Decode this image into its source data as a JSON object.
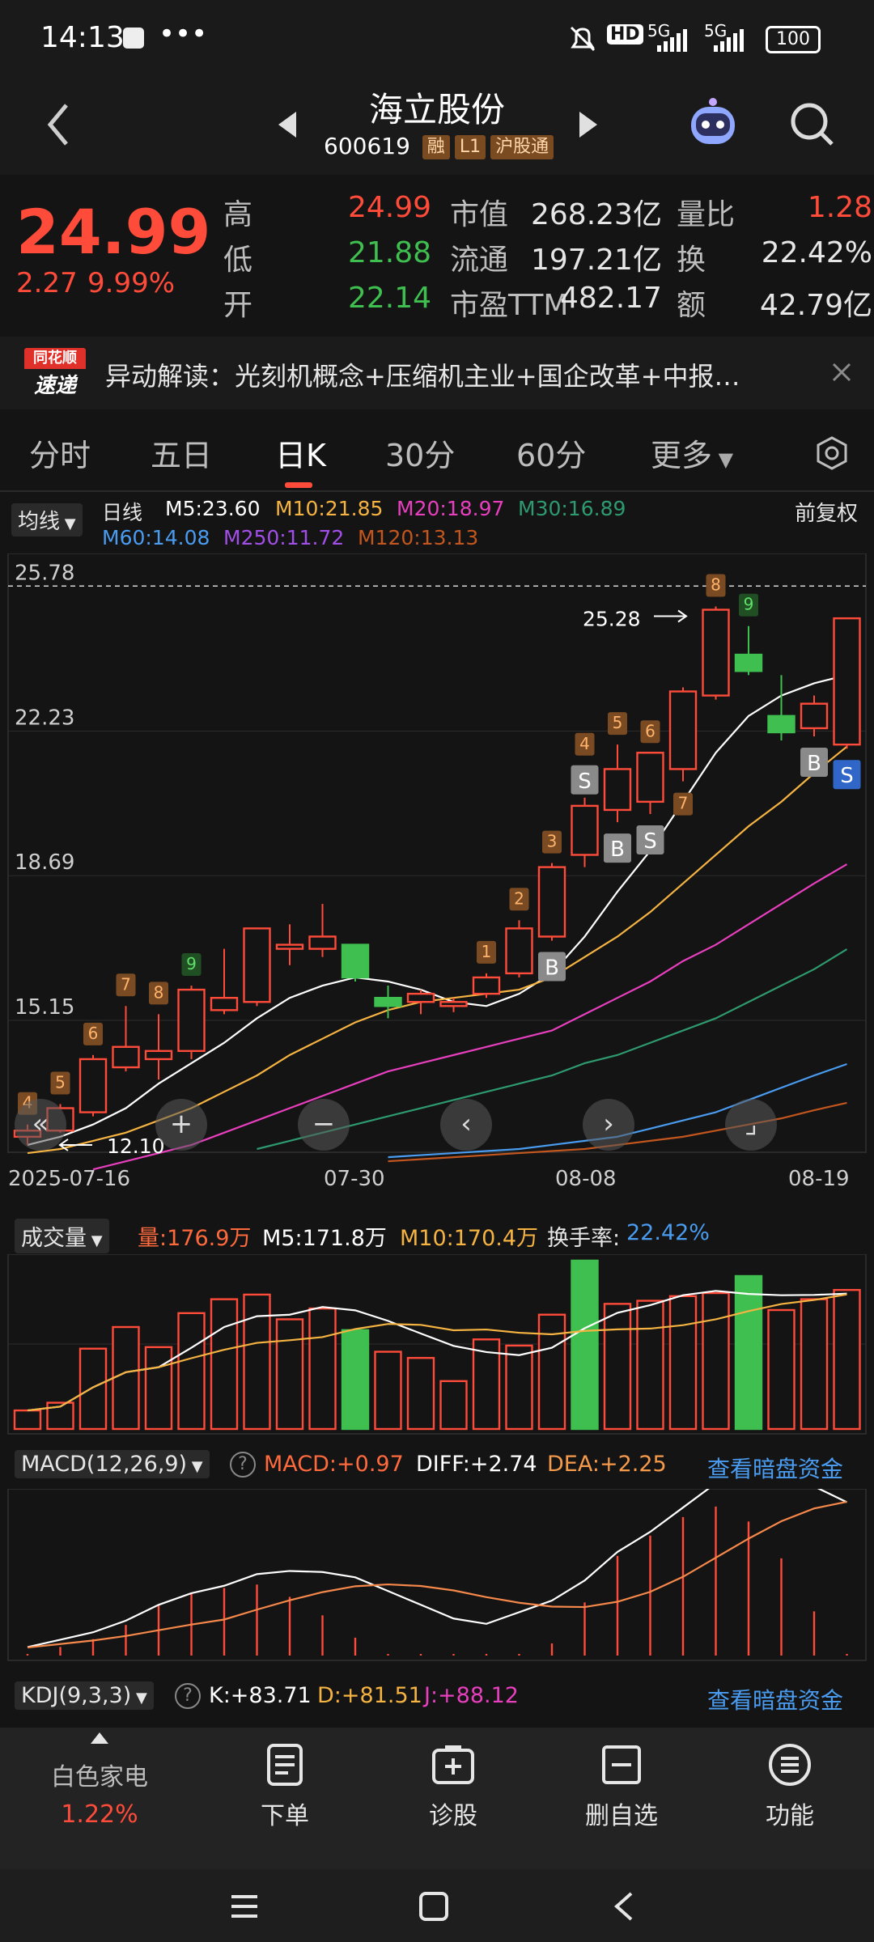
{
  "status": {
    "time": "14:13",
    "dots": "•••",
    "hd": "HD",
    "net1": "5G",
    "net2": "5G",
    "battery": "100"
  },
  "header": {
    "title": "海立股份",
    "code": "600619",
    "badges": [
      "融",
      "L1",
      "沪股通"
    ]
  },
  "quote": {
    "price": "24.99",
    "change": "2.27",
    "change_pct": "9.99%",
    "high_label": "高",
    "high": "24.99",
    "low_label": "低",
    "low": "21.88",
    "open_label": "开",
    "open": "22.14",
    "mcap_label": "市值",
    "mcap": "268.23亿",
    "float_label": "流通",
    "float": "197.21亿",
    "pe_label": "市盈TTM",
    "pe": "482.17",
    "volratio_label": "量比",
    "volratio": "1.28",
    "turnover_label": "换",
    "turnover": "22.42%",
    "amount_label": "额",
    "amount": "42.79亿"
  },
  "news": {
    "logo_top": "同花顺",
    "logo_bottom": "速递",
    "text": "异动解读：光刻机概念+压缩机主业+国企改革+中报…"
  },
  "tabs": [
    "分时",
    "五日",
    "日K",
    "30分",
    "60分",
    "更多"
  ],
  "ma_row": {
    "selector": "均线",
    "period": "日线",
    "m5": "M5:23.60",
    "m10": "M10:21.85",
    "m20": "M20:18.97",
    "m30": "M30:16.89",
    "m60": "M60:14.08",
    "m250": "M250:11.72",
    "m120": "M120:13.13",
    "adjust": "前复权",
    "colors": {
      "m5": "#ffffff",
      "m10": "#f5b342",
      "m20": "#e83fbf",
      "m30": "#2e9a6f",
      "m60": "#4a9cf0",
      "m250": "#a24ee8",
      "m120": "#c2561e"
    }
  },
  "chart_data": {
    "type": "candlestick",
    "y_ticks": [
      "25.78",
      "22.23",
      "18.69",
      "15.15"
    ],
    "x_ticks": [
      "2025-07-16",
      "07-30",
      "08-08",
      "08-19"
    ],
    "ylim": [
      12.0,
      26.3
    ],
    "high_annotation": "25.28",
    "low_annotation": "12.10",
    "candles": [
      {
        "o": 12.3,
        "h": 12.6,
        "l": 12.1,
        "c": 12.45
      },
      {
        "o": 12.45,
        "h": 13.1,
        "l": 12.4,
        "c": 13.0
      },
      {
        "o": 12.9,
        "h": 14.3,
        "l": 12.8,
        "c": 14.2
      },
      {
        "o": 14.0,
        "h": 15.5,
        "l": 13.9,
        "c": 14.5
      },
      {
        "o": 14.2,
        "h": 15.3,
        "l": 13.7,
        "c": 14.4
      },
      {
        "o": 14.4,
        "h": 16.0,
        "l": 14.2,
        "c": 15.9
      },
      {
        "o": 15.4,
        "h": 16.9,
        "l": 15.3,
        "c": 15.7
      },
      {
        "o": 15.6,
        "h": 17.3,
        "l": 15.5,
        "c": 17.4
      },
      {
        "o": 16.9,
        "h": 17.5,
        "l": 16.5,
        "c": 17.0
      },
      {
        "o": 16.9,
        "h": 18.0,
        "l": 16.7,
        "c": 17.2
      },
      {
        "o": 17.0,
        "h": 17.0,
        "l": 16.1,
        "c": 16.2
      },
      {
        "o": 15.7,
        "h": 16.0,
        "l": 15.2,
        "c": 15.5
      },
      {
        "o": 15.6,
        "h": 15.9,
        "l": 15.3,
        "c": 15.8
      },
      {
        "o": 15.5,
        "h": 15.7,
        "l": 15.35,
        "c": 15.6
      },
      {
        "o": 15.8,
        "h": 16.3,
        "l": 15.7,
        "c": 16.2
      },
      {
        "o": 16.3,
        "h": 17.6,
        "l": 16.2,
        "c": 17.4
      },
      {
        "o": 17.2,
        "h": 19.0,
        "l": 17.1,
        "c": 18.9
      },
      {
        "o": 19.2,
        "h": 20.6,
        "l": 18.9,
        "c": 20.4
      },
      {
        "o": 20.3,
        "h": 21.9,
        "l": 20.0,
        "c": 21.3
      },
      {
        "o": 20.5,
        "h": 21.7,
        "l": 20.2,
        "c": 21.7
      },
      {
        "o": 21.3,
        "h": 23.3,
        "l": 21.0,
        "c": 23.2
      },
      {
        "o": 23.1,
        "h": 25.28,
        "l": 23.0,
        "c": 25.2
      },
      {
        "o": 24.1,
        "h": 24.8,
        "l": 23.6,
        "c": 23.7
      },
      {
        "o": 22.6,
        "h": 23.6,
        "l": 22.0,
        "c": 22.2
      },
      {
        "o": 22.3,
        "h": 23.1,
        "l": 22.1,
        "c": 22.9
      },
      {
        "o": 21.9,
        "h": 25.0,
        "l": 21.8,
        "c": 24.99
      }
    ],
    "series": [
      {
        "name": "M5",
        "values": [
          12.1,
          12.3,
          12.6,
          13.0,
          13.6,
          14.1,
          14.6,
          15.2,
          15.7,
          16.0,
          16.2,
          16.1,
          15.9,
          15.6,
          15.5,
          15.8,
          16.3,
          17.2,
          18.3,
          19.3,
          20.5,
          21.7,
          22.6,
          23.1,
          23.4,
          23.6
        ]
      },
      {
        "name": "M10",
        "values": [
          11.9,
          12.0,
          12.2,
          12.4,
          12.7,
          13.0,
          13.4,
          13.8,
          14.3,
          14.7,
          15.1,
          15.4,
          15.6,
          15.7,
          15.8,
          15.9,
          16.2,
          16.7,
          17.2,
          17.8,
          18.5,
          19.2,
          19.9,
          20.5,
          21.2,
          21.85
        ]
      },
      {
        "name": "M20",
        "values": [
          null,
          null,
          11.5,
          11.7,
          11.9,
          12.1,
          12.4,
          12.7,
          13.0,
          13.3,
          13.6,
          13.9,
          14.1,
          14.3,
          14.5,
          14.7,
          14.9,
          15.3,
          15.7,
          16.1,
          16.6,
          17.0,
          17.5,
          18.0,
          18.5,
          18.97
        ]
      },
      {
        "name": "M30",
        "values": [
          null,
          null,
          null,
          null,
          null,
          null,
          null,
          12.0,
          12.2,
          12.4,
          12.6,
          12.8,
          13.0,
          13.2,
          13.4,
          13.6,
          13.8,
          14.1,
          14.3,
          14.6,
          14.9,
          15.2,
          15.6,
          16.0,
          16.4,
          16.89
        ]
      },
      {
        "name": "M60",
        "values": [
          null,
          null,
          null,
          null,
          null,
          null,
          null,
          null,
          null,
          null,
          null,
          11.8,
          11.85,
          11.9,
          11.95,
          12.0,
          12.1,
          12.2,
          12.3,
          12.5,
          12.7,
          12.9,
          13.2,
          13.5,
          13.8,
          14.08
        ]
      },
      {
        "name": "M120",
        "values": [
          null,
          null,
          null,
          null,
          null,
          null,
          null,
          null,
          null,
          null,
          null,
          11.7,
          11.75,
          11.8,
          11.85,
          11.9,
          11.95,
          12.0,
          12.1,
          12.2,
          12.3,
          12.45,
          12.6,
          12.75,
          12.95,
          13.13
        ]
      }
    ],
    "markers": [
      {
        "i": 0,
        "t": "4",
        "pos": "above",
        "kind": "orange"
      },
      {
        "i": 1,
        "t": "5",
        "pos": "above",
        "kind": "orange"
      },
      {
        "i": 2,
        "t": "6",
        "pos": "above",
        "kind": "orange"
      },
      {
        "i": 3,
        "t": "7",
        "pos": "above",
        "kind": "orange"
      },
      {
        "i": 4,
        "t": "8",
        "pos": "above",
        "kind": "orange"
      },
      {
        "i": 5,
        "t": "9",
        "pos": "above",
        "kind": "green"
      },
      {
        "i": 14,
        "t": "1",
        "pos": "above",
        "kind": "orange"
      },
      {
        "i": 15,
        "t": "2",
        "pos": "above",
        "kind": "orange"
      },
      {
        "i": 16,
        "t": "3",
        "pos": "above",
        "kind": "orange"
      },
      {
        "i": 16,
        "t": "B",
        "pos": "below",
        "kind": "gray"
      },
      {
        "i": 17,
        "t": "S",
        "pos": "above",
        "kind": "gray"
      },
      {
        "i": 17,
        "t": "4",
        "pos": "above2",
        "kind": "orange"
      },
      {
        "i": 18,
        "t": "5",
        "pos": "above",
        "kind": "orange"
      },
      {
        "i": 18,
        "t": "B",
        "pos": "below",
        "kind": "gray"
      },
      {
        "i": 19,
        "t": "S",
        "pos": "below",
        "kind": "gray"
      },
      {
        "i": 19,
        "t": "6",
        "pos": "above",
        "kind": "orange"
      },
      {
        "i": 20,
        "t": "7",
        "pos": "below",
        "kind": "orange"
      },
      {
        "i": 21,
        "t": "8",
        "pos": "above",
        "kind": "orange"
      },
      {
        "i": 22,
        "t": "9",
        "pos": "above",
        "kind": "green"
      },
      {
        "i": 24,
        "t": "B",
        "pos": "below",
        "kind": "gray"
      },
      {
        "i": 25,
        "t": "S",
        "pos": "below",
        "kind": "blue"
      }
    ]
  },
  "volume": {
    "selector": "成交量",
    "amount": "量:176.9万",
    "m5": "M5:171.8万",
    "m10": "M10:170.4万",
    "turnover_label": "换手率:",
    "turnover": "22.42%",
    "bars": [
      0.12,
      0.17,
      0.52,
      0.66,
      0.53,
      0.75,
      0.84,
      0.87,
      0.71,
      0.78,
      0.64,
      0.5,
      0.46,
      0.31,
      0.58,
      0.54,
      0.74,
      1.09,
      0.81,
      0.83,
      0.86,
      0.88,
      0.99,
      0.77,
      0.84,
      0.9
    ],
    "down": [
      10,
      17,
      22
    ]
  },
  "macd": {
    "selector": "MACD(12,26,9)",
    "macd": "MACD:+0.97",
    "diff": "DIFF:+2.74",
    "dea": "DEA:+2.25",
    "link": "查看暗盘资金"
  },
  "kdj": {
    "selector": "KDJ(9,3,3)",
    "k": "K:+83.71",
    "d": "D:+81.51",
    "j": "J:+88.12",
    "link": "查看暗盘资金"
  },
  "bottom_nav": {
    "sector": "白色家电",
    "sector_pct": "1.22%",
    "items": [
      "下单",
      "诊股",
      "删自选",
      "功能"
    ]
  }
}
